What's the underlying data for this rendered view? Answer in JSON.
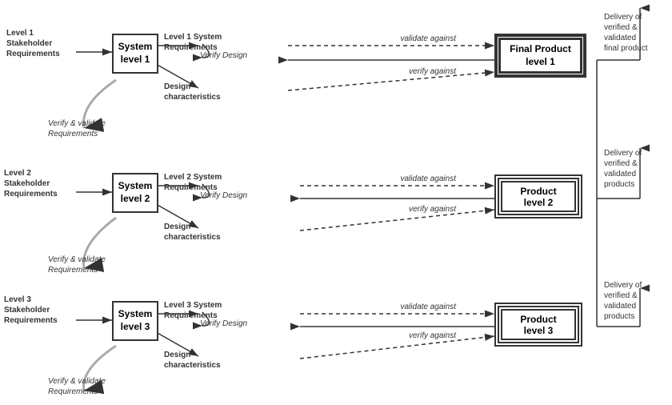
{
  "boxes": {
    "system1": {
      "label": "System\nlevel 1"
    },
    "system2": {
      "label": "System\nlevel 2"
    },
    "system3": {
      "label": "System\nlevel 3"
    },
    "product1": {
      "label": "Final Product\nlevel 1"
    },
    "product2": {
      "label": "Product\nlevel 2"
    },
    "product3": {
      "label": "Product\nlevel 3"
    }
  },
  "labels": {
    "stk1": "Level 1\nStakeholder\nRequirements",
    "stk2": "Level 2\nStakeholder\nRequirements",
    "stk3": "Level 3\nStakeholder\nRequirements",
    "sysreq1": "Level 1 System\nRequirements",
    "sysreq2": "Level 2 System\nRequirements",
    "sysreq3": "Level 3 System\nRequirements",
    "design1": "Design\ncharacteristics",
    "design2": "Design\ncharacteristics",
    "design3": "Design\ncharacteristics",
    "verifyDesign1": "Verify Design",
    "verifyDesign2": "Verify Design",
    "verifyDesign3": "Verify Design",
    "validateAgainst1": "validate against",
    "validateAgainst2": "validate against",
    "validateAgainst3": "validate against",
    "verifyAgainst1": "verify against",
    "verifyAgainst2": "verify against",
    "verifyAgainst3": "verify against",
    "vvReq1": "Verify & validate\nRequirements",
    "vvReq2": "Verify & validate\nRequirements",
    "vvReq3": "Verify & validate\nRequirements",
    "delivery1": "Delivery of\nverified &\nvalidated\nfinal product",
    "delivery2": "Delivery of\nverified &\nvalidated\nproducts",
    "delivery3": "Delivery of\nverified &\nvalidated\nproducts"
  }
}
